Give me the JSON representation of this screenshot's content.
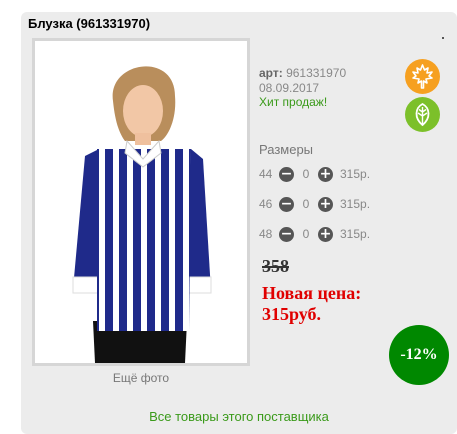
{
  "product": {
    "title": "Блузка (961331970)",
    "art_label": "арт:",
    "art_value": "961331970",
    "date": "08.09.2017",
    "hit_label": "Хит продаж!",
    "more_photo": "Ещё фото"
  },
  "badges": [
    {
      "name": "autumn",
      "icon": "maple-leaf-icon",
      "color": "#f6a020"
    },
    {
      "name": "spring",
      "icon": "leaf-icon",
      "color": "#7cc02a"
    }
  ],
  "sizes": {
    "title": "Размеры",
    "rows": [
      {
        "size": "44",
        "qty": "0",
        "price": "315р."
      },
      {
        "size": "46",
        "qty": "0",
        "price": "315р."
      },
      {
        "size": "48",
        "qty": "0",
        "price": "315р."
      }
    ]
  },
  "pricing": {
    "old_price": "358",
    "new_price_label": "Новая цена:",
    "new_price_value": "315руб.",
    "discount": "-12%"
  },
  "footer": {
    "supplier_link": "Все товары этого поставщика"
  },
  "colors": {
    "card_bg": "#ececec",
    "accent_green": "#3a9a1a",
    "price_red": "#e00000",
    "discount_bg": "#008800"
  }
}
